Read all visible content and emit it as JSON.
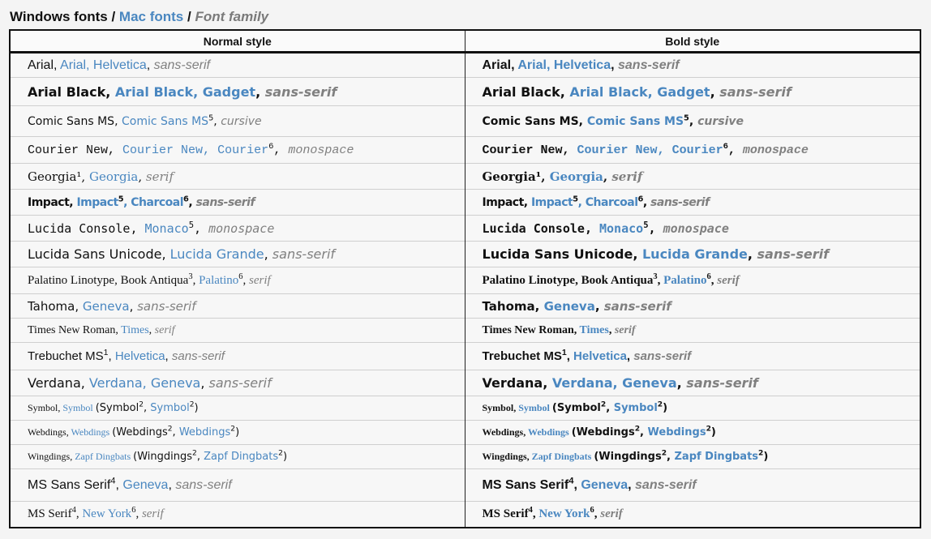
{
  "legend": {
    "windows": "Windows fonts",
    "mac": "Mac fonts",
    "family": "Font family",
    "separator": "/"
  },
  "headers": {
    "normal": "Normal style",
    "bold": "Bold style"
  },
  "rows": [
    {
      "win": "Arial",
      "win_sup": "",
      "sep1": ", ",
      "mac": "Arial, Helvetica",
      "mac_sup": "",
      "mac2": "",
      "mac2_sup": "",
      "sep2": ", ",
      "gen": "sans-serif",
      "font": "\"Liberation Sans\", sans-serif",
      "size": "16px",
      "height": 31
    },
    {
      "win": "Arial Black",
      "win_sup": "",
      "sep1": ", ",
      "mac": "Arial Black, Gadget",
      "mac_sup": "",
      "mac2": "",
      "mac2_sup": "",
      "sep2": ", ",
      "gen": "sans-serif",
      "font": "\"DejaVu Sans\", sans-serif",
      "size": "16px",
      "weight": "bold",
      "height": 35
    },
    {
      "win": "Comic Sans MS",
      "win_sup": "",
      "sep1": ", ",
      "mac": "Comic Sans MS",
      "mac_sup": "5",
      "mac2": "",
      "mac2_sup": "",
      "sep2": ", ",
      "gen": "cursive",
      "font": "\"DejaVu Sans\", sans-serif",
      "size": "14px",
      "height": 38
    },
    {
      "win": "Courier New",
      "win_sup": "",
      "sep1": ", ",
      "mac": "Courier New, Courier",
      "mac_sup": "6",
      "mac2": "",
      "mac2_sup": "",
      "sep2": ", ",
      "gen": "monospace",
      "font": "\"Liberation Mono\", monospace",
      "size": "15px",
      "height": 33
    },
    {
      "win": "Georgia¹",
      "win_sup": "",
      "sep1": ", ",
      "mac": "Georgia",
      "mac_sup": "",
      "mac2": "",
      "mac2_sup": "",
      "sep2": ", ",
      "gen": "serif",
      "font": "\"DejaVu Serif\", serif",
      "size": "15px",
      "height": 32
    },
    {
      "win": "Impact",
      "win_sup": "",
      "sep1": ", ",
      "mac": "Impact",
      "mac_sup": "5",
      "mac2": ", Charcoal",
      "mac2_sup": "6",
      "sep2": ", ",
      "gen": "sans-serif",
      "font": "\"DejaVu Sans\", sans-serif",
      "size": "14px",
      "weight": "bold",
      "stretch": true,
      "height": 32
    },
    {
      "win": "Lucida Console",
      "win_sup": "",
      "sep1": ", ",
      "mac": "Monaco",
      "mac_sup": "5",
      "mac2": "",
      "mac2_sup": "",
      "sep2": ", ",
      "gen": "monospace",
      "font": "\"DejaVu Sans Mono\", monospace",
      "size": "15px",
      "height": 32
    },
    {
      "win": "Lucida Sans Unicode",
      "win_sup": "",
      "sep1": ", ",
      "mac": "Lucida Grande",
      "mac_sup": "",
      "mac2": "",
      "mac2_sup": "",
      "sep2": ", ",
      "gen": "sans-serif",
      "font": "\"DejaVu Sans\", sans-serif",
      "size": "16px",
      "height": 32
    },
    {
      "win": "Palatino Linotype, Book Antiqua",
      "win_sup": "3",
      "sep1": ", ",
      "mac": "Palatino",
      "mac_sup": "6",
      "mac2": "",
      "mac2_sup": "",
      "sep2": ", ",
      "gen": "serif",
      "font": "\"Liberation Serif\", serif",
      "size": "15px",
      "height": 33
    },
    {
      "win": "Tahoma",
      "win_sup": "",
      "sep1": ", ",
      "mac": "Geneva",
      "mac_sup": "",
      "mac2": "",
      "mac2_sup": "",
      "sep2": ", ",
      "gen": "sans-serif",
      "font": "\"DejaVu Sans\", sans-serif",
      "size": "15px",
      "height": 30
    },
    {
      "win": "Times New Roman",
      "win_sup": "",
      "sep1": ", ",
      "mac": "Times",
      "mac_sup": "",
      "mac2": "",
      "mac2_sup": "",
      "sep2": ", ",
      "gen": "serif",
      "font": "\"Liberation Serif\", serif",
      "size": "14px",
      "height": 30
    },
    {
      "win": "Trebuchet MS",
      "win_sup": "1",
      "sep1": ", ",
      "mac": "Helvetica",
      "mac_sup": "",
      "mac2": "",
      "mac2_sup": "",
      "sep2": ", ",
      "gen": "sans-serif",
      "font": "\"Liberation Sans\", sans-serif",
      "size": "15px",
      "height": 34
    },
    {
      "win": "Verdana",
      "win_sup": "",
      "sep1": ", ",
      "mac": "Verdana, Geneva",
      "mac_sup": "",
      "mac2": "",
      "mac2_sup": "",
      "sep2": ", ",
      "gen": "sans-serif",
      "font": "\"DejaVu Sans\", sans-serif",
      "size": "16px",
      "height": 32
    },
    {
      "win": "Symbol",
      "win_sup": "",
      "sep1": ", ",
      "mac": "Symbol",
      "mac_sup": "",
      "mac2": "",
      "mac2_sup": "",
      "sep2": " ",
      "gen": "",
      "extra": "(Symbol², Symbol²)",
      "font": "\"Liberation Serif\", serif",
      "size": "12px",
      "height": 30
    },
    {
      "win": "Webdings",
      "win_sup": "",
      "sep1": ", ",
      "mac": "Webdings",
      "mac_sup": "",
      "mac2": "",
      "mac2_sup": "",
      "sep2": " ",
      "gen": "",
      "extra": "(Webdings², Webdings²)",
      "font": "\"Liberation Serif\", serif",
      "size": "12px",
      "height": 30
    },
    {
      "win": "Wingdings",
      "win_sup": "",
      "sep1": ", ",
      "mac": "Zapf Dingbats",
      "mac_sup": "",
      "mac2": "",
      "mac2_sup": "",
      "sep2": " ",
      "gen": "",
      "extra": "(Wingdings², Zapf Dingbats²)",
      "font": "\"Liberation Serif\", serif",
      "size": "12px",
      "height": 30
    },
    {
      "win": "MS Sans Serif",
      "win_sup": "4",
      "sep1": ", ",
      "mac": "Geneva",
      "mac_sup": "",
      "mac2": "",
      "mac2_sup": "",
      "sep2": ", ",
      "gen": "sans-serif",
      "font": "\"Liberation Sans\", sans-serif",
      "size": "16px",
      "height": 40
    },
    {
      "win": "MS Serif",
      "win_sup": "4",
      "sep1": ", ",
      "mac": "New York",
      "mac_sup": "6",
      "mac2": "",
      "mac2_sup": "",
      "sep2": ", ",
      "gen": "serif",
      "font": "\"Liberation Serif\", serif",
      "size": "15px",
      "height": 32
    }
  ]
}
